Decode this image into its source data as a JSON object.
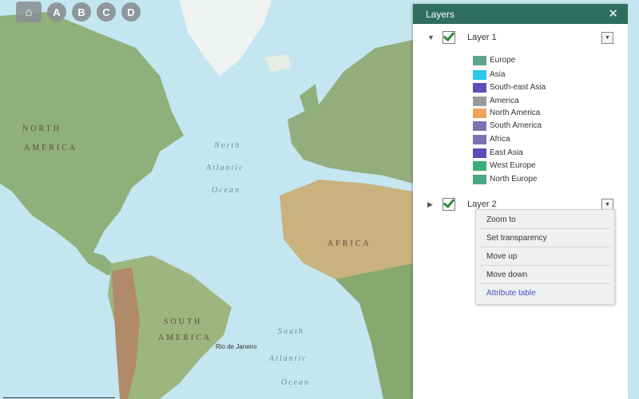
{
  "map": {
    "ocean_labels": [
      "North",
      "Atlantic",
      "Ocean",
      "South",
      "Atlantic",
      "Ocean"
    ],
    "land_labels": [
      "NORTH",
      "AMERICA",
      "AFRICA",
      "SOUTH",
      "AMERICA"
    ],
    "city_labels": [
      "Rio de Janeiro"
    ],
    "colors": {
      "ocean": "#c4e6f0",
      "land": "#8fb07a",
      "land_dry": "#c9b27e",
      "ice": "#eef3f1"
    }
  },
  "toolbar": {
    "home_icon": "home-zoom-icon",
    "buttons": [
      "A",
      "B",
      "C",
      "D"
    ]
  },
  "panel": {
    "title": "Layers",
    "close_icon": "close-icon",
    "header_color": "#2e6e5c",
    "layers": [
      {
        "name": "Layer 1",
        "expanded": true,
        "checked": true
      },
      {
        "name": "Layer 2",
        "expanded": false,
        "checked": true
      }
    ],
    "legend": [
      {
        "label": "Europe",
        "color": "#5fa58a"
      },
      {
        "label": "Asia",
        "color": "#29c6e8"
      },
      {
        "label": "South-east Asia",
        "color": "#5b52b8"
      },
      {
        "label": "America",
        "color": "#9a9aa0"
      },
      {
        "label": "North America",
        "color": "#f2a35a"
      },
      {
        "label": "South America",
        "color": "#7a76ad"
      },
      {
        "label": "Africa",
        "color": "#7a72b4"
      },
      {
        "label": "East Asia",
        "color": "#5a4fb5"
      },
      {
        "label": "West Europe",
        "color": "#3cae74"
      },
      {
        "label": "North Europe",
        "color": "#4aa882"
      }
    ]
  },
  "context_menu": {
    "items": [
      "Zoom to",
      "Set transparency",
      "Move up",
      "Move down"
    ],
    "link_item": "Attribute table"
  }
}
